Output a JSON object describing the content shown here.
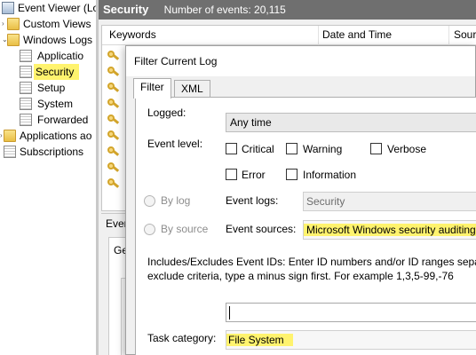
{
  "tree": {
    "items": [
      {
        "label": "Event Viewer (Loc",
        "icon": "event-viewer-icon"
      },
      {
        "label": "Custom Views",
        "icon": "folder-icon"
      },
      {
        "label": "Windows Logs",
        "icon": "folder-icon"
      },
      {
        "label": "Applicatio",
        "icon": "log-icon"
      },
      {
        "label": "Security",
        "icon": "log-icon",
        "highlighted": true
      },
      {
        "label": "Setup",
        "icon": "log-icon"
      },
      {
        "label": "System",
        "icon": "log-icon"
      },
      {
        "label": "Forwarded",
        "icon": "log-icon"
      },
      {
        "label": "Applications ao",
        "icon": "folder-icon"
      },
      {
        "label": "Subscriptions",
        "icon": "log-icon"
      }
    ]
  },
  "main": {
    "title": "Security",
    "count_text": "Number of events: 20,115",
    "columns": [
      "Keywords",
      "Date and Time",
      "Sourc"
    ],
    "row_icon": "key-icon",
    "lower_tab": "Even",
    "lower_subtab": "Ge"
  },
  "dialog": {
    "title": "Filter Current Log",
    "tabs": [
      "Filter",
      "XML"
    ],
    "logged_label": "Logged:",
    "logged_value": "Any time",
    "level_label": "Event level:",
    "levels": [
      "Critical",
      "Warning",
      "Verbose",
      "Error",
      "Information"
    ],
    "by_log_label": "By log",
    "by_source_label": "By source",
    "event_logs_label": "Event logs:",
    "event_logs_value": "Security",
    "event_sources_label": "Event sources:",
    "event_sources_value": "Microsoft Windows security auditing",
    "ids_help_1": "Includes/Excludes Event IDs: Enter ID numbers and/or ID ranges separat",
    "ids_help_2": "exclude criteria, type a minus sign first. For example 1,3,5-99,-76",
    "ids_value": "",
    "task_category_label": "Task category:",
    "task_category_value": "File System"
  },
  "colors": {
    "highlight": "#fff36e",
    "header_bar": "#6f6f6f"
  }
}
